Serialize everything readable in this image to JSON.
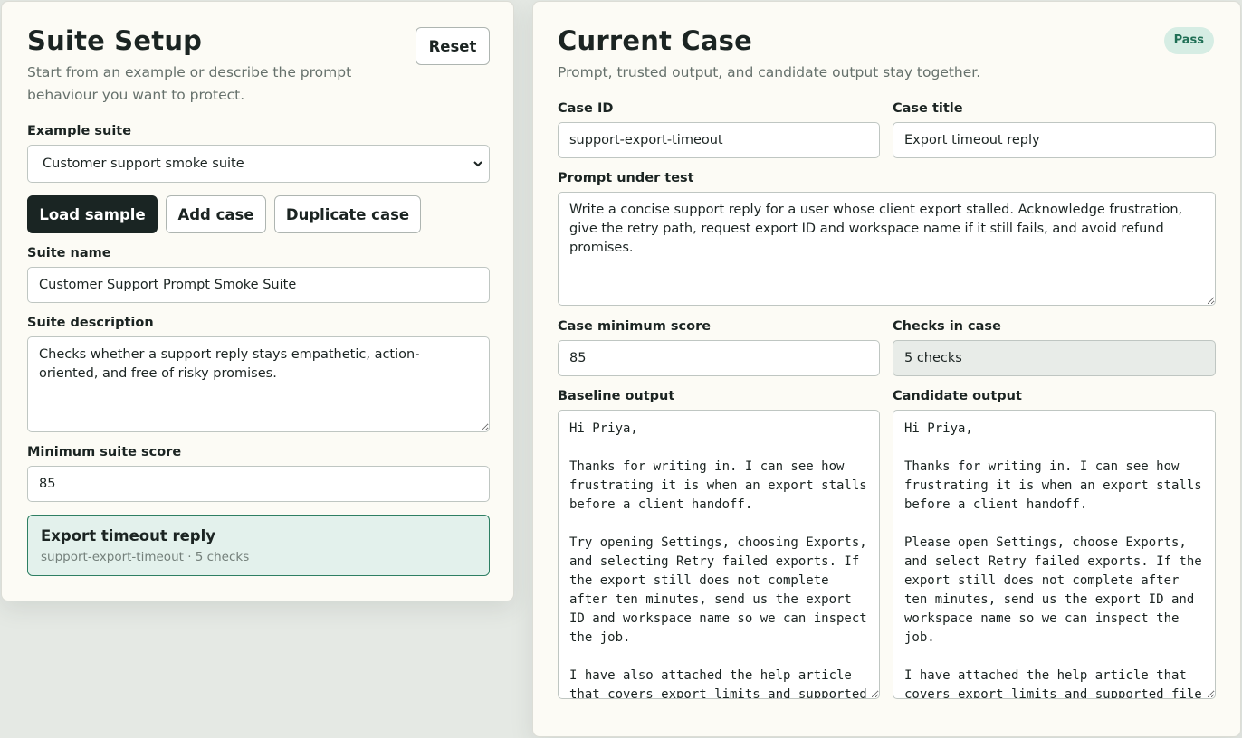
{
  "suite_setup": {
    "title": "Suite Setup",
    "subtitle": "Start from an example or describe the prompt behaviour you want to protect.",
    "reset_label": "Reset",
    "example_suite_label": "Example suite",
    "example_suite_value": "Customer support smoke suite",
    "load_sample_label": "Load sample",
    "add_case_label": "Add case",
    "duplicate_case_label": "Duplicate case",
    "suite_name_label": "Suite name",
    "suite_name_value": "Customer Support Prompt Smoke Suite",
    "suite_description_label": "Suite description",
    "suite_description_value": "Checks whether a support reply stays empathetic, action-oriented, and free of risky promises.",
    "min_suite_score_label": "Minimum suite score",
    "min_suite_score_value": "85",
    "cases": [
      {
        "title": "Export timeout reply",
        "meta": "support-export-timeout · 5 checks"
      }
    ]
  },
  "current_case": {
    "title": "Current Case",
    "subtitle": "Prompt, trusted output, and candidate output stay together.",
    "status_badge": "Pass",
    "case_id_label": "Case ID",
    "case_id_value": "support-export-timeout",
    "case_title_label": "Case title",
    "case_title_value": "Export timeout reply",
    "prompt_label": "Prompt under test",
    "prompt_value": "Write a concise support reply for a user whose client export stalled. Acknowledge frustration, give the retry path, request export ID and workspace name if it still fails, and avoid refund promises.",
    "case_min_score_label": "Case minimum score",
    "case_min_score_value": "85",
    "checks_label": "Checks in case",
    "checks_value": "5 checks",
    "baseline_label": "Baseline output",
    "baseline_value": "Hi Priya,\n\nThanks for writing in. I can see how frustrating it is when an export stalls before a client handoff.\n\nTry opening Settings, choosing Exports, and selecting Retry failed exports. If the export still does not complete after ten minutes, send us the export ID and workspace name so we can inspect the job.\n\nI have also attached the help article that covers export limits and supported file types.",
    "candidate_label": "Candidate output",
    "candidate_value": "Hi Priya,\n\nThanks for writing in. I can see how frustrating it is when an export stalls before a client handoff.\n\nPlease open Settings, choose Exports, and select Retry failed exports. If the export still does not complete after ten minutes, send us the export ID and workspace name so we can inspect the job.\n\nI have attached the help article that covers export limits and supported file types."
  },
  "colors": {
    "page_bg": "#e5e9e4",
    "panel_bg": "#fcfbf5",
    "primary_button": "#1a2523",
    "selected_case_bg": "#e3f1ec",
    "selected_case_border": "#2e7f63",
    "pass_badge_bg": "#d6ede4",
    "pass_badge_text": "#1f6f55"
  }
}
